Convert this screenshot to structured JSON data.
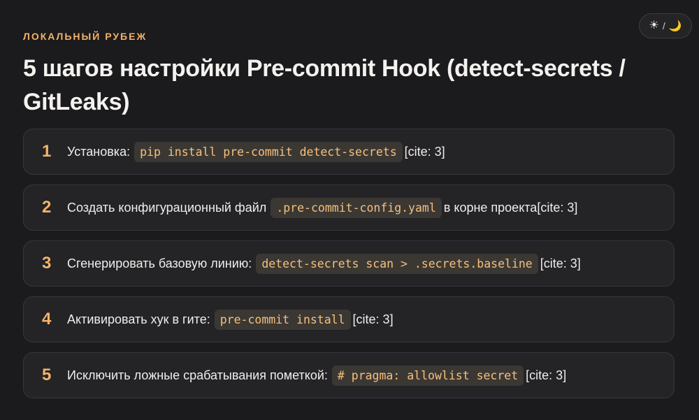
{
  "theme_toggle": {
    "sun_glyph": "☀",
    "separator": "/",
    "moon_glyph": "🌙"
  },
  "header": {
    "kicker": "ЛОКАЛЬНЫЙ РУБЕЖ",
    "title": "5 шагов настройки Pre-commit Hook (detect-secrets / GitLeaks)"
  },
  "steps": [
    {
      "number": "1",
      "text_before": "Установка:",
      "code": "pip install pre-commit detect-secrets",
      "text_after": "[cite: 3]"
    },
    {
      "number": "2",
      "text_before": "Создать конфигурационный файл",
      "code": ".pre-commit-config.yaml",
      "text_after": "в корне проекта[cite: 3]"
    },
    {
      "number": "3",
      "text_before": "Сгенерировать базовую линию:",
      "code": "detect-secrets scan > .secrets.baseline",
      "text_after": "[cite: 3]"
    },
    {
      "number": "4",
      "text_before": "Активировать хук в гите:",
      "code": "pre-commit install",
      "text_after": "[cite: 3]"
    },
    {
      "number": "5",
      "text_before": "Исключить ложные срабатывания пометкой:",
      "code": "# pragma: allowlist secret",
      "text_after": "[cite: 3]"
    }
  ],
  "colors": {
    "background": "#1b1a1c",
    "card": "#242326",
    "accent": "#f2b36a",
    "code_bg": "#3b3834"
  }
}
